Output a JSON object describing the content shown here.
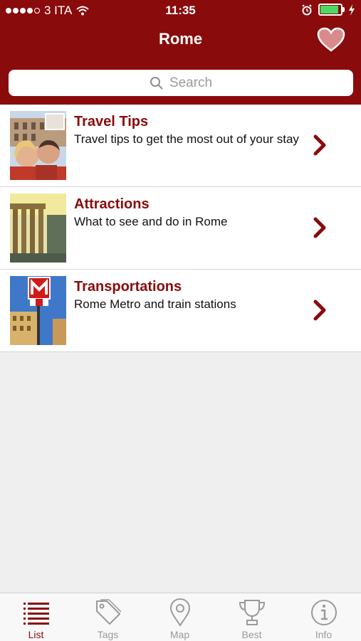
{
  "status": {
    "carrier": "3 ITA",
    "time": "11:35",
    "battery_level": 0.9
  },
  "nav": {
    "title": "Rome",
    "favorite_icon": "heart-icon"
  },
  "search": {
    "placeholder": "Search"
  },
  "items": [
    {
      "title": "Travel Tips",
      "description": "Travel tips to get the most out of your stay",
      "image": "colosseum-selfie-photo"
    },
    {
      "title": "Attractions",
      "description": "What to see and do in Rome",
      "image": "roman-forum-photo"
    },
    {
      "title": "Transportations",
      "description": "Rome Metro and train stations",
      "image": "metro-sign-photo"
    }
  ],
  "tabs": [
    {
      "label": "List",
      "icon": "list-icon",
      "active": true
    },
    {
      "label": "Tags",
      "icon": "tag-icon",
      "active": false
    },
    {
      "label": "Map",
      "icon": "map-pin-icon",
      "active": false
    },
    {
      "label": "Best",
      "icon": "trophy-icon",
      "active": false
    },
    {
      "label": "Info",
      "icon": "info-icon",
      "active": false
    }
  ],
  "colors": {
    "brand": "#8a0b0b",
    "background": "#efefef",
    "battery": "#4cd964",
    "inactive_tab": "#9a9a9a"
  }
}
